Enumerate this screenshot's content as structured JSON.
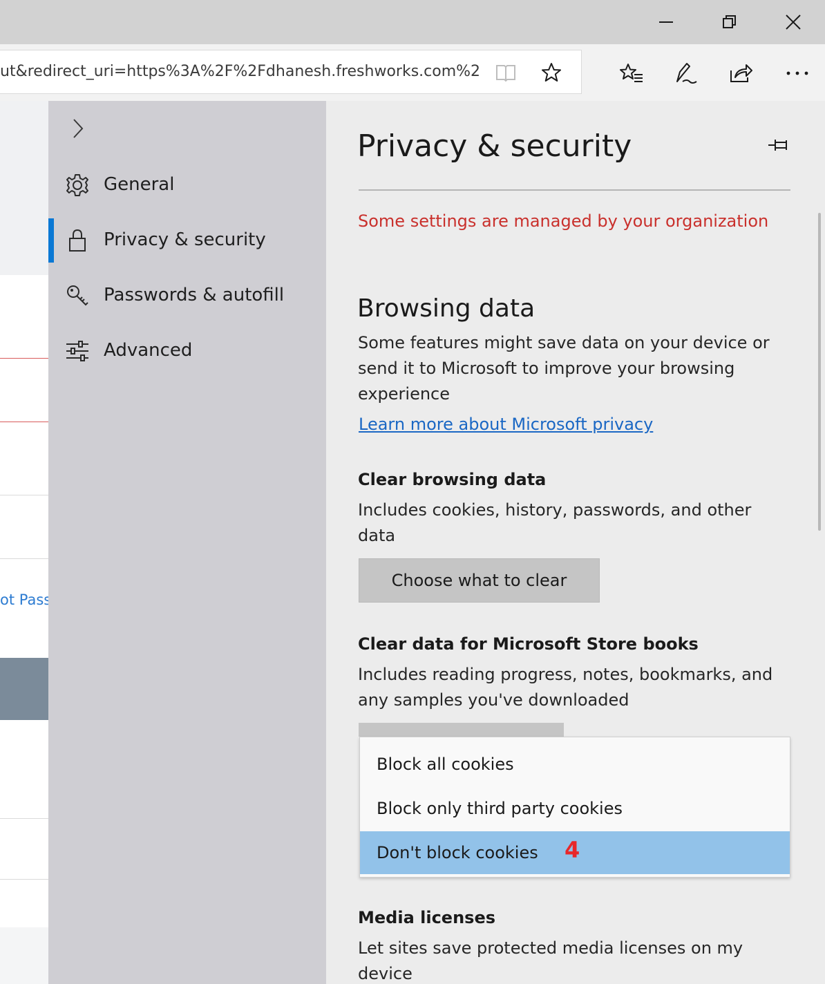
{
  "window": {
    "controls": {
      "minimize_icon": "minimize-icon",
      "restore_icon": "restore-icon",
      "close_icon": "close-icon"
    }
  },
  "toolbar": {
    "address_text": "ut&redirect_uri=https%3A%2F%2Fdhanesh.freshworks.com%2",
    "icons": [
      "reading-view-icon",
      "favorite-star-icon",
      "favorites-hub-icon",
      "web-note-icon",
      "share-icon",
      "more-icon"
    ]
  },
  "page_sliver": {
    "link_text": "ot Pass"
  },
  "nav": {
    "items": [
      {
        "label": "General",
        "icon": "gear-icon"
      },
      {
        "label": "Privacy & security",
        "icon": "lock-icon",
        "active": true
      },
      {
        "label": "Passwords & autofill",
        "icon": "key-icon"
      },
      {
        "label": "Advanced",
        "icon": "sliders-icon"
      }
    ],
    "accent_color": "#0a78d4"
  },
  "panel": {
    "title": "Privacy & security",
    "managed_notice": "Some settings are managed by your organization",
    "browsing": {
      "heading": "Browsing data",
      "description": "Some features might save data on your device or send it to Microsoft to improve your browsing experience",
      "learn_more": "Learn more about Microsoft privacy"
    },
    "clear_browsing": {
      "heading": "Clear browsing data",
      "description": "Includes cookies, history, passwords, and other data",
      "button": "Choose what to clear"
    },
    "clear_books": {
      "heading": "Clear data for Microsoft Store books",
      "description": "Includes reading progress, notes, bookmarks, and any samples you've downloaded"
    },
    "cookies_dropdown": {
      "options": [
        "Block all cookies",
        "Block only third party cookies",
        "Don't block cookies"
      ],
      "selected": "Don't block cookies",
      "annotation": "4"
    },
    "media": {
      "heading": "Media licenses",
      "description": "Let sites save protected media licenses on my device"
    }
  },
  "colors": {
    "warning": "#c9302c",
    "link": "#1a67c4",
    "selected_option": "#92c2e9"
  }
}
